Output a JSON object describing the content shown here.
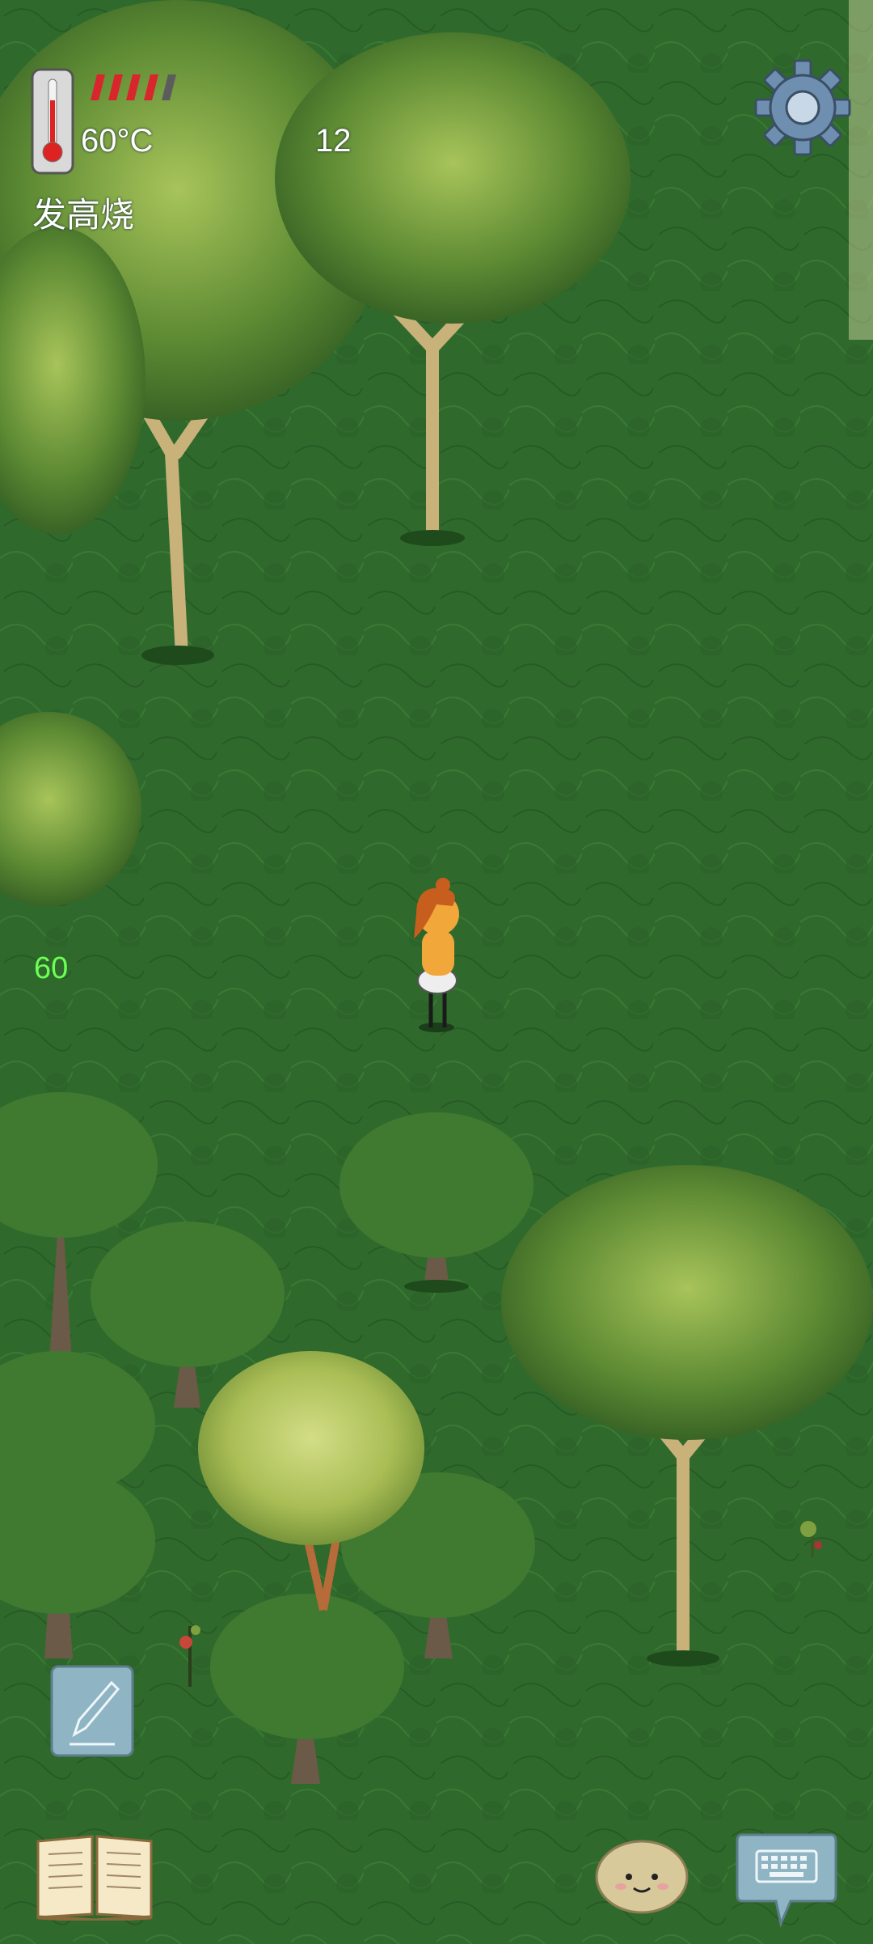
{
  "hud": {
    "temperature": "60°C",
    "day_count": "12",
    "status": "发高烧",
    "fps": "60",
    "health_bar": {
      "segments_total": 5,
      "segments_filled": 4
    }
  },
  "colors": {
    "grass": "#2f6a2c",
    "health_red": "#d8262c",
    "fps_green": "#6cff55",
    "button_blue": "#8fb4c3"
  },
  "icons": {
    "thermometer": "thermometer-icon",
    "settings": "gear-icon",
    "notes": "pencil-icon",
    "journal": "book-icon",
    "emote": "smiley-face-icon",
    "chat": "keyboard-icon"
  }
}
